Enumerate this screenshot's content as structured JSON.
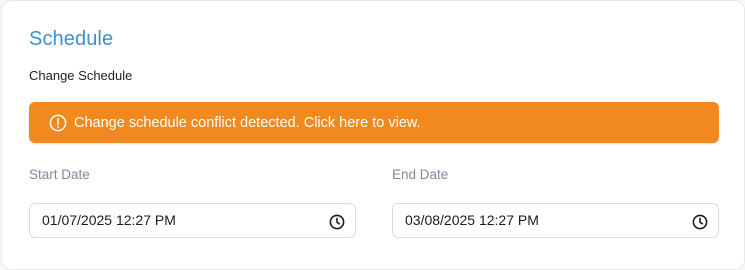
{
  "schedule": {
    "title": "Schedule",
    "subtitle": "Change Schedule"
  },
  "alert": {
    "icon": "exclamation-circle-icon",
    "message": "Change schedule conflict detected. Click here to view.",
    "color": "#f2891f"
  },
  "start_date": {
    "label": "Start Date",
    "value": "01/07/2025 12:27 PM",
    "icon": "clock-icon"
  },
  "end_date": {
    "label": "End Date",
    "value": "03/08/2025 12:27 PM",
    "icon": "clock-icon"
  },
  "colors": {
    "title": "#3d8fd1",
    "label": "#7d8aa1",
    "alert_bg": "#f2891f"
  }
}
